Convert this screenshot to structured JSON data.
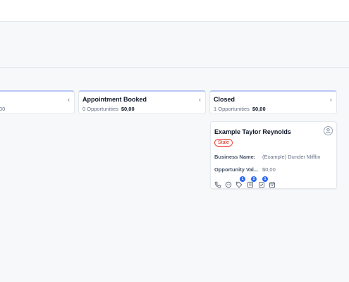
{
  "columns": [
    {
      "title": "",
      "opportunities": "",
      "amount": "00"
    },
    {
      "title": "Appointment Booked",
      "opportunities": "0 Opportunities",
      "amount": "$0,00"
    },
    {
      "title": "Closed",
      "opportunities": "1 Opportunities",
      "amount": "$0,00"
    }
  ],
  "card": {
    "name": "Example Taylor Reynolds",
    "tag": "Stale",
    "fields": [
      {
        "label": "Business Name:",
        "value": "(Example) Dunder Mifflin"
      },
      {
        "label": "Opportunity Val...",
        "value": "$0,00"
      }
    ],
    "icons": [
      {
        "name": "phone-icon",
        "badge": ""
      },
      {
        "name": "chat-icon",
        "badge": ""
      },
      {
        "name": "tag-icon",
        "badge": "1"
      },
      {
        "name": "notes-icon",
        "badge": "2"
      },
      {
        "name": "tasks-icon",
        "badge": "1"
      },
      {
        "name": "calendar-icon",
        "badge": ""
      }
    ]
  },
  "colors": {
    "accent": "#2e69f3",
    "tag_red": "#d92d20",
    "header_top_border": "#b9c7f5"
  }
}
